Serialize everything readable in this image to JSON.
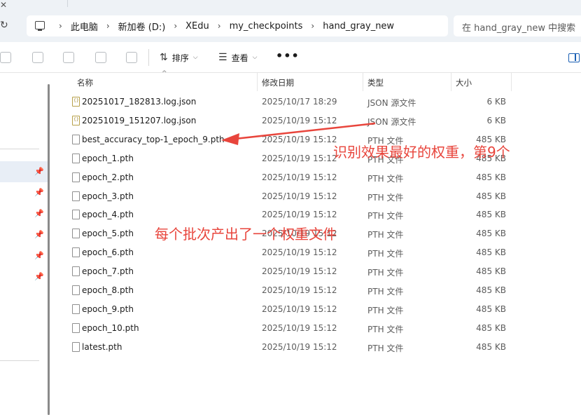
{
  "address": {
    "crumbs": [
      "此电脑",
      "新加卷 (D:)",
      "XEdu",
      "my_checkpoints",
      "hand_gray_new"
    ],
    "search_placeholder": "在 hand_gray_new 中搜索"
  },
  "toolbar": {
    "sort_label": "排序",
    "view_label": "查看",
    "more_label": "•••"
  },
  "columns": {
    "name": "名称",
    "modified": "修改日期",
    "type": "类型",
    "size": "大小"
  },
  "files": [
    {
      "name": "20251017_182813.log.json",
      "modified": "2025/10/17 18:29",
      "type": "JSON 源文件",
      "size": "6 KB",
      "icon": "json-file-icon"
    },
    {
      "name": "20251019_151207.log.json",
      "modified": "2025/10/19 15:12",
      "type": "JSON 源文件",
      "size": "6 KB",
      "icon": "json-file-icon"
    },
    {
      "name": "best_accuracy_top-1_epoch_9.pth",
      "modified": "2025/10/19 15:12",
      "type": "PTH 文件",
      "size": "485 KB",
      "icon": "file-icon"
    },
    {
      "name": "epoch_1.pth",
      "modified": "2025/10/19 15:12",
      "type": "PTH 文件",
      "size": "485 KB",
      "icon": "file-icon"
    },
    {
      "name": "epoch_2.pth",
      "modified": "2025/10/19 15:12",
      "type": "PTH 文件",
      "size": "485 KB",
      "icon": "file-icon"
    },
    {
      "name": "epoch_3.pth",
      "modified": "2025/10/19 15:12",
      "type": "PTH 文件",
      "size": "485 KB",
      "icon": "file-icon"
    },
    {
      "name": "epoch_4.pth",
      "modified": "2025/10/19 15:12",
      "type": "PTH 文件",
      "size": "485 KB",
      "icon": "file-icon"
    },
    {
      "name": "epoch_5.pth",
      "modified": "2025/10/19 15:12",
      "type": "PTH 文件",
      "size": "485 KB",
      "icon": "file-icon"
    },
    {
      "name": "epoch_6.pth",
      "modified": "2025/10/19 15:12",
      "type": "PTH 文件",
      "size": "485 KB",
      "icon": "file-icon"
    },
    {
      "name": "epoch_7.pth",
      "modified": "2025/10/19 15:12",
      "type": "PTH 文件",
      "size": "485 KB",
      "icon": "file-icon"
    },
    {
      "name": "epoch_8.pth",
      "modified": "2025/10/19 15:12",
      "type": "PTH 文件",
      "size": "485 KB",
      "icon": "file-icon"
    },
    {
      "name": "epoch_9.pth",
      "modified": "2025/10/19 15:12",
      "type": "PTH 文件",
      "size": "485 KB",
      "icon": "file-icon"
    },
    {
      "name": "epoch_10.pth",
      "modified": "2025/10/19 15:12",
      "type": "PTH 文件",
      "size": "485 KB",
      "icon": "file-icon"
    },
    {
      "name": "latest.pth",
      "modified": "2025/10/19 15:12",
      "type": "PTH 文件",
      "size": "485 KB",
      "icon": "file-icon"
    }
  ],
  "annotations": {
    "best_note": "识别效果最好的权重，第9个",
    "epoch_note": "每个批次产出了一个权重文件",
    "color": "#e8453c"
  }
}
